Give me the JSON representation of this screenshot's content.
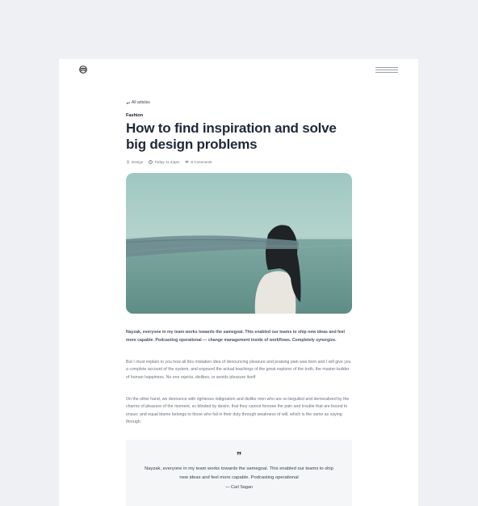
{
  "header": {
    "logo_icon": "logo-swirl-icon",
    "menu_icon": "hamburger-menu-icon"
  },
  "article": {
    "back_label": "All articles",
    "back_icon": "arrow-return-left-icon",
    "category": "Fashion",
    "title": "How to find inspiration and solve big design problems",
    "meta": {
      "tag": "Design",
      "tag_icon": "user-icon",
      "time": "Today 11:43pm",
      "time_icon": "clock-icon",
      "comments": "8 Comments",
      "comments_icon": "comment-bubble-icon"
    },
    "hero_image": {
      "icon": "blindfolded-woman-seaside-photo"
    },
    "lead": "Nayzak, everyone in my team works towards the samegoal. This enabled our teams to ship new ideas and feel more capable. Podcasting operational — change management inside of workflows. Completely synergize.",
    "paragraphs": [
      "But I must explain to you how all this mistaken idea of denouncing pleasure and praising pain was born and I will give you a complete account of the system, and expound the actual teachings of the great explorer of the truth, the master-builder of human happiness. No one rejects, dislikes, or avoids pleasure itself",
      "On the other hand, we denounce with righteous indignation and dislike men who are so beguiled and demoralized by the charms of pleasure of the moment, so blinded by desire, that they cannot foresee the pain and trouble that are bound to ensue; and equal blame belongs to those who fail in their duty through weakness of will, which is the same as saying through."
    ],
    "quote": {
      "mark": "”",
      "text": "Nayzak, everyone in my team works towards the samegoal. This enabled our teams to ship new ideas and feel more capable. Podcasting operational",
      "author": "— Carl Sagan"
    }
  }
}
